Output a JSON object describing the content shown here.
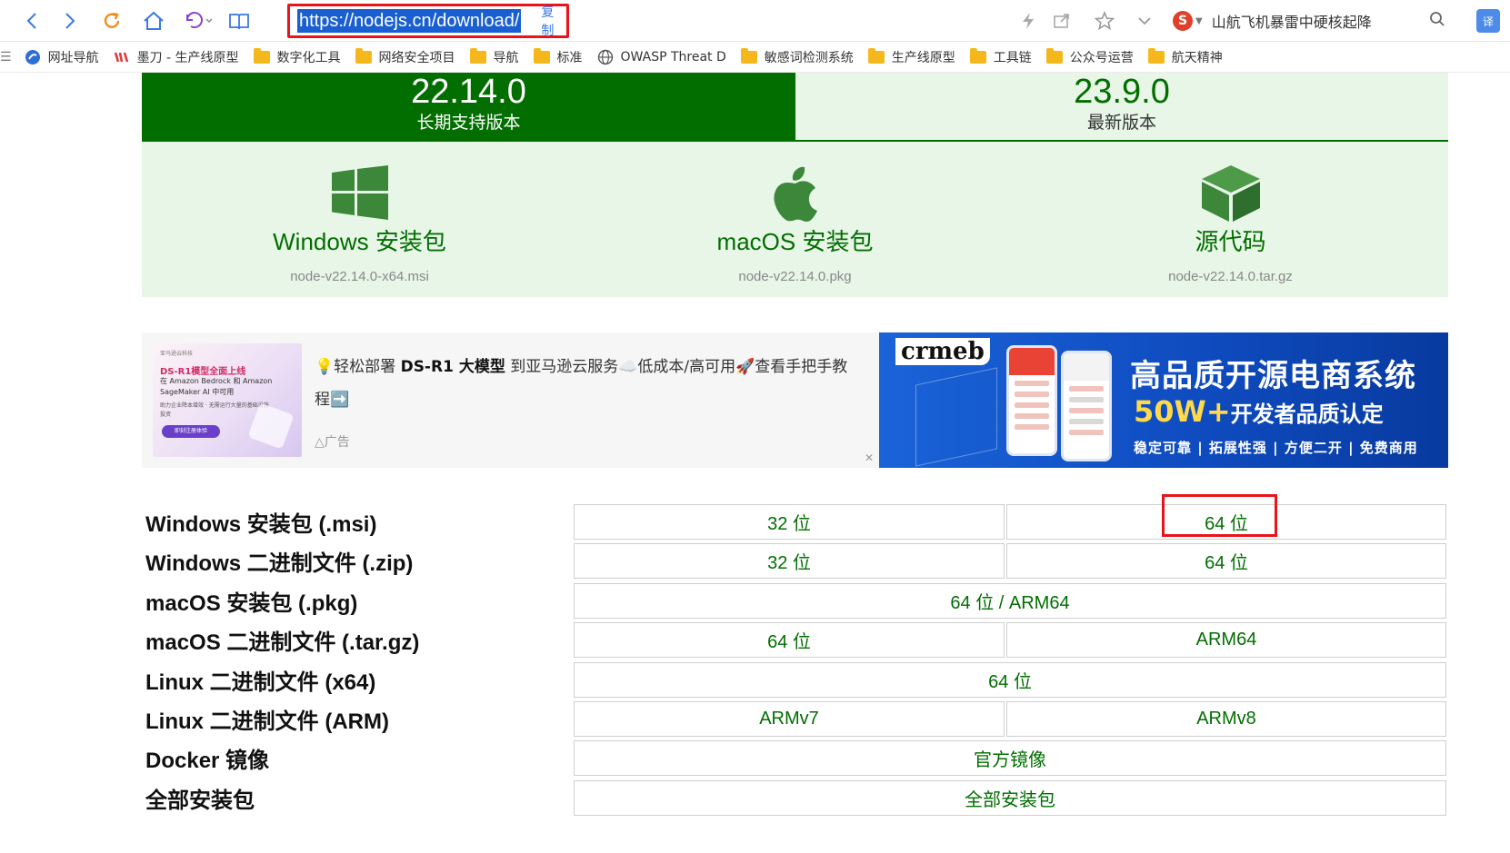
{
  "browser": {
    "url": "https://nodejs.cn/download/",
    "copy_label": "复制",
    "search_text": "山航飞机暴雷中硬核起降",
    "translate_label": "译"
  },
  "bookmarks": [
    {
      "label": "网址导航",
      "icon": "navigation-icon"
    },
    {
      "label": "墨刀 - 生产线原型",
      "icon": "modao-icon"
    },
    {
      "label": "数字化工具",
      "icon": "folder-icon"
    },
    {
      "label": "网络安全项目",
      "icon": "folder-icon"
    },
    {
      "label": "导航",
      "icon": "folder-icon"
    },
    {
      "label": "标准",
      "icon": "folder-icon"
    },
    {
      "label": "OWASP Threat D",
      "icon": "globe-icon"
    },
    {
      "label": "敏感词检测系统",
      "icon": "folder-icon"
    },
    {
      "label": "生产线原型",
      "icon": "folder-icon"
    },
    {
      "label": "工具链",
      "icon": "folder-icon"
    },
    {
      "label": "公众号运营",
      "icon": "folder-icon"
    },
    {
      "label": "航天精神",
      "icon": "folder-icon"
    }
  ],
  "versions": {
    "lts": {
      "number": "22.14.0",
      "label": "长期支持版本"
    },
    "current": {
      "number": "23.9.0",
      "label": "最新版本"
    }
  },
  "downloads": [
    {
      "name": "Windows 安装包",
      "file": "node-v22.14.0-x64.msi",
      "icon": "windows-icon"
    },
    {
      "name": "macOS 安装包",
      "file": "node-v22.14.0.pkg",
      "icon": "apple-icon"
    },
    {
      "name": "源代码",
      "file": "node-v22.14.0.tar.gz",
      "icon": "cube-icon"
    }
  ],
  "ad_left": {
    "thumb_brand": "亚马逊云科技",
    "thumb_title": "DS-R1模型全面上线",
    "thumb_sub": "在 Amazon Bedrock 和 Amazon SageMaker AI 中可用",
    "thumb_points": "助力企业降本增效 · 无需运行大量的基础设施投资",
    "thumb_button": "即刻注册体验",
    "text_prefix": "💡轻松部署 ",
    "text_bold": "DS-R1 大模型",
    "text_suffix": " 到亚马逊云服务☁️低成本/高可用🚀查看手把手教程➡️",
    "ad_mark": "广告",
    "close": "✕"
  },
  "ad_right": {
    "brand": "crmeb",
    "headline": "高品质开源电商系统",
    "count": "50W+",
    "sub": "开发者品质认定",
    "tags": "稳定可靠 | 拓展性强 | 方便二开 | 免费商用"
  },
  "table": {
    "rows": [
      {
        "label": "Windows 安装包 (.msi)",
        "cells": [
          "32 位",
          "64 位"
        ]
      },
      {
        "label": "Windows 二进制文件 (.zip)",
        "cells": [
          "32 位",
          "64 位"
        ]
      },
      {
        "label": "macOS 安装包 (.pkg)",
        "cells": [
          "64 位 / ARM64"
        ]
      },
      {
        "label": "macOS 二进制文件 (.tar.gz)",
        "cells": [
          "64 位",
          "ARM64"
        ]
      },
      {
        "label": "Linux 二进制文件 (x64)",
        "cells": [
          "64 位"
        ]
      },
      {
        "label": "Linux 二进制文件 (ARM)",
        "cells": [
          "ARMv7",
          "ARMv8"
        ]
      },
      {
        "label": "Docker 镜像",
        "cells": [
          "官方镜像"
        ]
      },
      {
        "label": "全部安装包",
        "cells": [
          "全部安装包"
        ]
      }
    ]
  },
  "colors": {
    "node_green": "#026e00",
    "panel_bg": "#e8f6e8",
    "highlight_red": "#e8141a"
  }
}
